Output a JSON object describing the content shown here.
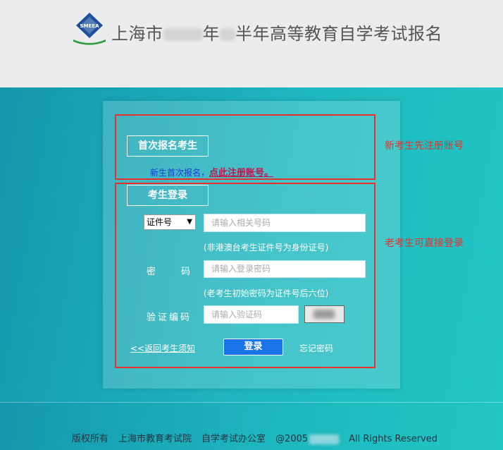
{
  "header": {
    "title_part1": "上海市",
    "title_part2": "年",
    "title_part3": "半年高等教育自学考试报名",
    "logo_text": "SMEEA"
  },
  "new_section": {
    "tag": "首次报名考生",
    "prompt": "新生首次报名，",
    "link": "点此注册账号。",
    "side_note": "新考生先注册账号"
  },
  "login_section": {
    "tag": "考生登录",
    "side_note": "老考生可直接登录",
    "id_type_selected": "证件号",
    "id_placeholder": "请输入相关号码",
    "id_hint": "(非港澳台考生证件号为身份证号)",
    "password_label_1": "密",
    "password_label_2": "码",
    "password_placeholder": "请输入登录密码",
    "password_hint": "(老考生初始密码为证件号后六位)",
    "captcha_label": "验证编码",
    "captcha_placeholder": "请输入验证码",
    "back_link": "<<返回考生须知",
    "login_button": "登录",
    "forgot_link": "忘记密码"
  },
  "footer": {
    "copyright": "版权所有",
    "org1": "上海市教育考试院",
    "org2": "自学考试办公室",
    "year_prefix": "@2005",
    "rights": "All  Rights  Reserved"
  },
  "colors": {
    "accent_red": "#e8312a",
    "button_blue": "#1b73e8",
    "link_magenta": "#c5124a",
    "bg_teal": "#1aa6b7"
  }
}
